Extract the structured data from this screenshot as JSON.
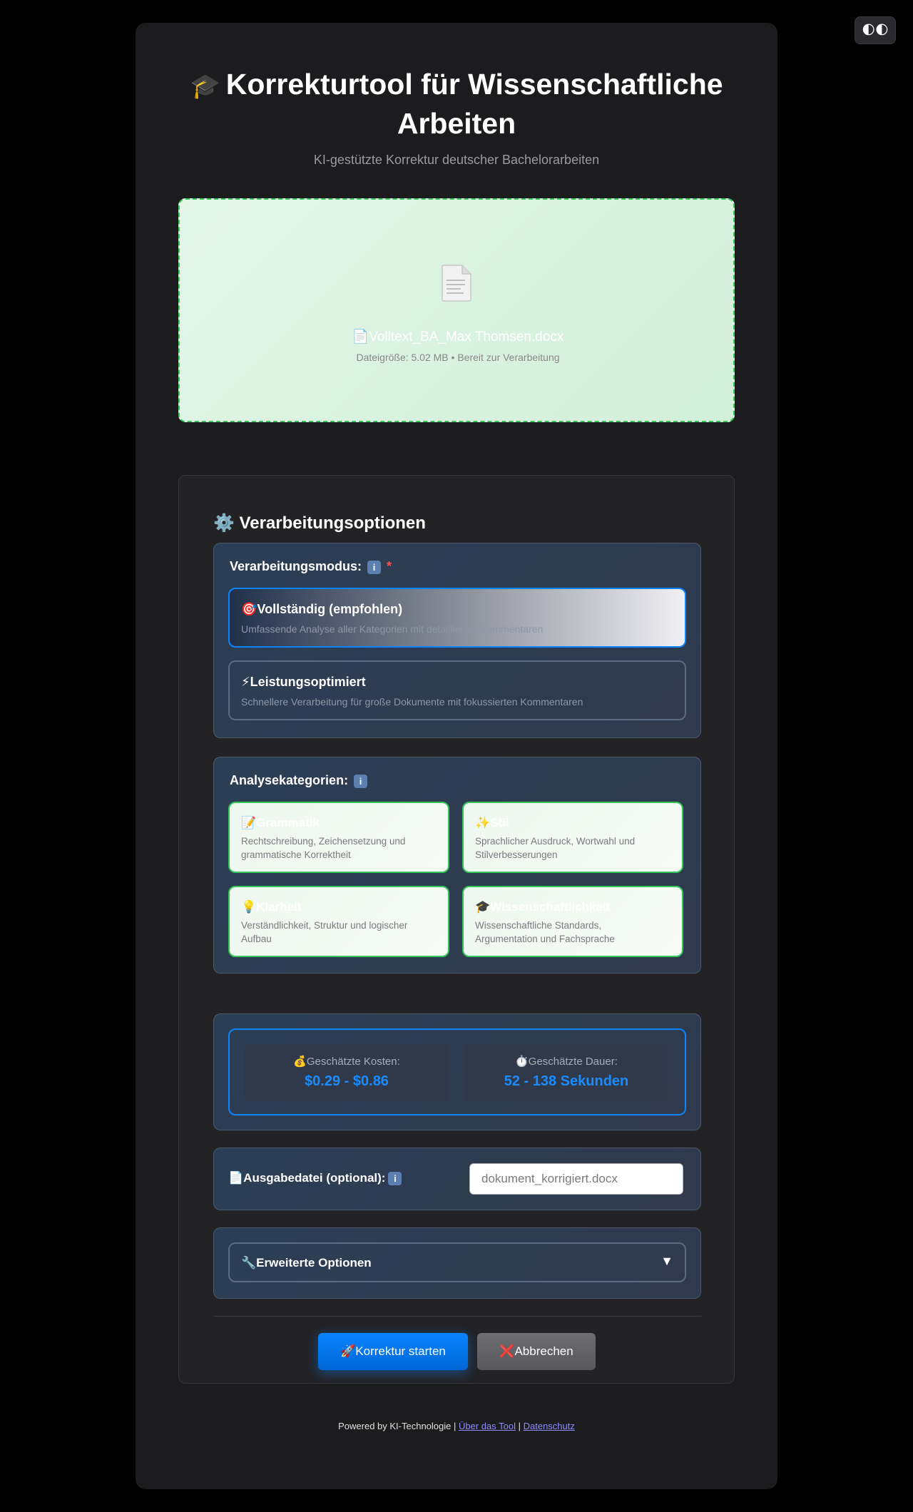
{
  "theme_toggle": {
    "icon": "moon-icon",
    "glyph": "🌓🌓"
  },
  "header": {
    "cap_emoji": "🎓",
    "title": "Korrekturtool für Wissenschaftliche Arbeiten",
    "subtitle": "KI-gestützte Korrektur deutscher Bachelorarbeiten"
  },
  "upload": {
    "icon": "document-icon",
    "file_name": "📄Volltext_BA_Max Thomsen.docx",
    "file_meta": "Dateigröße: 5.02 MB • Bereit zur Verarbeitung"
  },
  "options": {
    "title": "⚙️ Verarbeitungsoptionen",
    "mode": {
      "label": "Verarbeitungsmodus:",
      "info": "i",
      "required": "*",
      "items": [
        {
          "title": "🎯Vollständig (empfohlen)",
          "desc": "Umfassende Analyse aller Kategorien mit detaillierten Kommentaren",
          "selected": true
        },
        {
          "title": "⚡Leistungsoptimiert",
          "desc": "Schnellere Verarbeitung für große Dokumente mit fokussierten Kommentaren",
          "selected": false
        }
      ]
    },
    "categories": {
      "label": "Analysekategorien:",
      "info": "i",
      "items": [
        {
          "title": "📝Grammatik",
          "desc": "Rechtschreibung, Zeichensetzung und grammatische Korrektheit"
        },
        {
          "title": "✨Stil",
          "desc": "Sprachlicher Ausdruck, Wortwahl und Stilverbesserungen"
        },
        {
          "title": "💡Klarheit",
          "desc": "Verständlichkeit, Struktur und logischer Aufbau"
        },
        {
          "title": "🎓Wissenschaftlichkeit",
          "desc": "Wissenschaftliche Standards, Argumentation und Fachsprache"
        }
      ]
    },
    "estimate": {
      "cost_label": "💰Geschätzte Kosten:",
      "cost_value": "$0.29 - $0.86",
      "duration_label": "⏱️Geschätzte Dauer:",
      "duration_value": "52 - 138 Sekunden"
    },
    "output": {
      "label": "📄Ausgabedatei (optional):",
      "info": "i",
      "placeholder": "dokument_korrigiert.docx"
    },
    "advanced": {
      "label": "🔧Erweiterte Optionen",
      "arrow": "▼"
    },
    "buttons": {
      "start": "🚀Korrektur starten",
      "cancel": "❌Abbrechen"
    }
  },
  "footer": {
    "prefix": "Powered by KI-Technologie |",
    "about": "Über das Tool",
    "sep": "|",
    "privacy": "Datenschutz"
  },
  "colors": {
    "accent": "#0a84ff",
    "success": "#34c759",
    "background": "#1c1c1e"
  }
}
